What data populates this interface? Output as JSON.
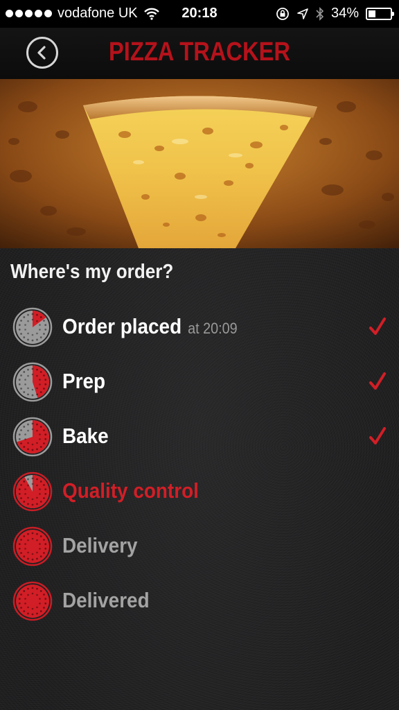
{
  "status_bar": {
    "carrier": "vodafone UK",
    "time": "20:18",
    "battery_percent": "34%",
    "battery_level": 0.34
  },
  "header": {
    "title": "PIZZA TRACKER",
    "back_icon": "chevron-left-circle-icon"
  },
  "section": {
    "title": "Where's my order?"
  },
  "colors": {
    "brand_red": "#b5121b",
    "active_red": "#d21e26",
    "done_text": "#ffffff",
    "pending_text": "#a3a3a3"
  },
  "steps": [
    {
      "label": "Order placed",
      "time": "at 20:09",
      "status": "done",
      "progress": 0.15
    },
    {
      "label": "Prep",
      "time": "",
      "status": "done",
      "progress": 0.45
    },
    {
      "label": "Bake",
      "time": "",
      "status": "done",
      "progress": 0.7
    },
    {
      "label": "Quality control",
      "time": "",
      "status": "active",
      "progress": 0.92
    },
    {
      "label": "Delivery",
      "time": "",
      "status": "pending",
      "progress": 1.0
    },
    {
      "label": "Delivered",
      "time": "",
      "status": "pending",
      "progress": 1.0
    }
  ]
}
